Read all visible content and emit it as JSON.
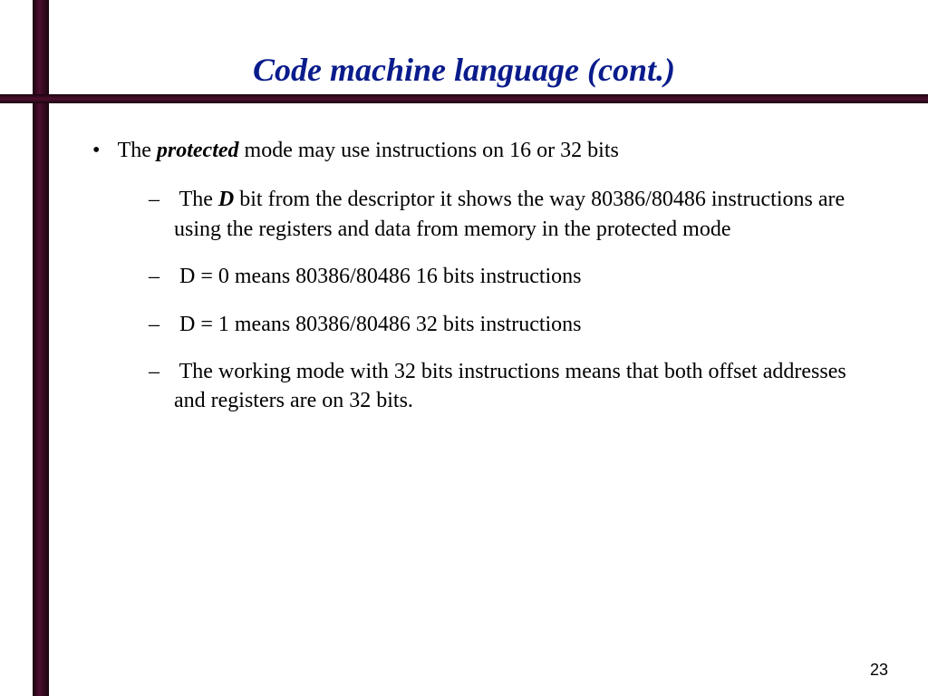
{
  "title": "Code machine language (cont.)",
  "page_number": "23",
  "bullet": {
    "pre": "The ",
    "bold": "protected",
    "post": " mode may use instructions on 16 or 32 bits"
  },
  "sub": [
    {
      "pre": "The ",
      "bold": "D",
      "post": " bit from the descriptor it shows the way 80386/80486 instructions are using the registers and data from memory in the protected mode"
    },
    {
      "text": "D = 0 means 80386/80486 16 bits instructions"
    },
    {
      "text": "D = 1 means 80386/80486 32 bits instructions"
    },
    {
      "text": "The working mode with 32 bits instructions means that both offset addresses and registers are on 32 bits."
    }
  ]
}
